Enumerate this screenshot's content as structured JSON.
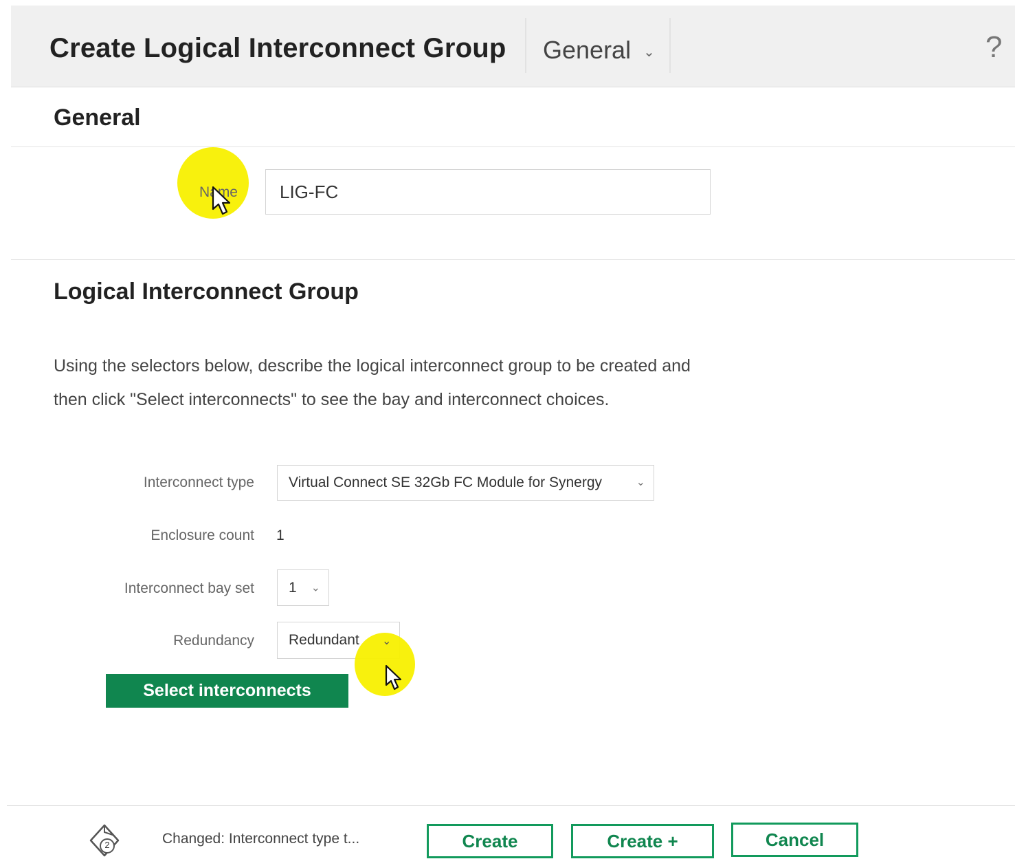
{
  "header": {
    "title": "Create Logical Interconnect Group",
    "section_selector": "General",
    "help_label": "?"
  },
  "general": {
    "heading": "General",
    "name_label": "Name",
    "name_value": "LIG-FC"
  },
  "lig": {
    "heading": "Logical Interconnect Group",
    "description": "Using the selectors below, describe the logical interconnect group to be created and then click \"Select interconnects\" to see the bay and interconnect choices.",
    "interconnect_type_label": "Interconnect type",
    "interconnect_type_value": "Virtual Connect SE 32Gb FC Module for Synergy",
    "enclosure_count_label": "Enclosure count",
    "enclosure_count_value": "1",
    "bay_set_label": "Interconnect bay set",
    "bay_set_value": "1",
    "redundancy_label": "Redundancy",
    "redundancy_value": "Redundant",
    "select_interconnects_label": "Select interconnects"
  },
  "footer": {
    "status_icon": "activity-icon",
    "status_badge": "2",
    "status_text": "Changed: Interconnect type t...",
    "create_label": "Create",
    "create_plus_label": "Create +",
    "cancel_label": "Cancel"
  },
  "colors": {
    "primary": "#10864f",
    "highlight": "#f8f000",
    "header_bg": "#f0f0f0"
  }
}
